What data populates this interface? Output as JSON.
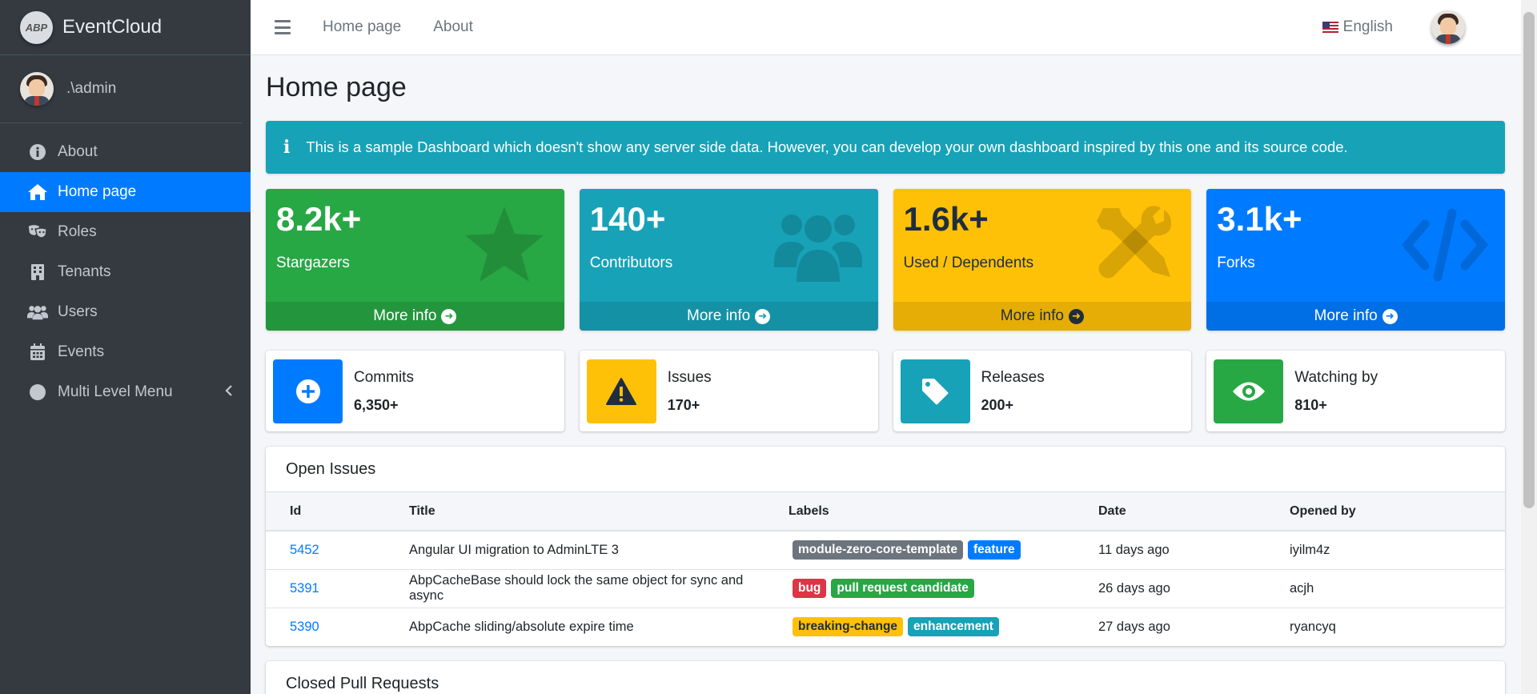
{
  "brand": {
    "name": "EventCloud",
    "logo_text": "ABP"
  },
  "user": {
    "name": ".\\admin"
  },
  "sidebar": {
    "items": [
      {
        "label": "About",
        "icon": "info-circle-icon",
        "active": false
      },
      {
        "label": "Home page",
        "icon": "home-icon",
        "active": true
      },
      {
        "label": "Roles",
        "icon": "theater-masks-icon",
        "active": false
      },
      {
        "label": "Tenants",
        "icon": "building-icon",
        "active": false
      },
      {
        "label": "Users",
        "icon": "users-icon",
        "active": false
      },
      {
        "label": "Events",
        "icon": "calendar-icon",
        "active": false
      },
      {
        "label": "Multi Level Menu",
        "icon": "circle-icon",
        "active": false
      }
    ]
  },
  "topbar": {
    "links": [
      "Home page",
      "About"
    ],
    "language": "English"
  },
  "page": {
    "title": "Home page",
    "callout": "This is a sample Dashboard which doesn't show any server side data. However, you can develop your own dashboard inspired by this one and its source code.",
    "callout_icon": "i"
  },
  "small_boxes": [
    {
      "value": "8.2k+",
      "label": "Stargazers",
      "more": "More info",
      "color": "#28a745",
      "icon": "star-icon"
    },
    {
      "value": "140+",
      "label": "Contributors",
      "more": "More info",
      "color": "#17a2b8",
      "icon": "users-icon"
    },
    {
      "value": "1.6k+",
      "label": "Used / Dependents",
      "more": "More info",
      "color": "#ffc107",
      "icon": "tools-icon"
    },
    {
      "value": "3.1k+",
      "label": "Forks",
      "more": "More info",
      "color": "#007bff",
      "icon": "code-icon"
    }
  ],
  "info_boxes": [
    {
      "label": "Commits",
      "number": "6,350+",
      "color": "#007bff",
      "icon": "plus-circle-icon"
    },
    {
      "label": "Issues",
      "number": "170+",
      "color": "#ffc107",
      "icon": "warning-icon"
    },
    {
      "label": "Releases",
      "number": "200+",
      "color": "#17a2b8",
      "icon": "tag-icon"
    },
    {
      "label": "Watching by",
      "number": "810+",
      "color": "#28a745",
      "icon": "eye-icon"
    }
  ],
  "open_issues": {
    "title": "Open Issues",
    "columns": [
      "Id",
      "Title",
      "Labels",
      "Date",
      "Opened by"
    ],
    "rows": [
      {
        "id": "5452",
        "title": "Angular UI migration to AdminLTE 3",
        "labels": [
          {
            "text": "module-zero-core-template",
            "color": "gray"
          },
          {
            "text": "feature",
            "color": "blue"
          }
        ],
        "date": "11 days ago",
        "by": "iyilm4z"
      },
      {
        "id": "5391",
        "title": "AbpCacheBase should lock the same object for sync and async",
        "labels": [
          {
            "text": "bug",
            "color": "red"
          },
          {
            "text": "pull request candidate",
            "color": "green"
          }
        ],
        "date": "26 days ago",
        "by": "acjh"
      },
      {
        "id": "5390",
        "title": "AbpCache sliding/absolute expire time",
        "labels": [
          {
            "text": "breaking-change",
            "color": "yellow"
          },
          {
            "text": "enhancement",
            "color": "teal"
          }
        ],
        "date": "27 days ago",
        "by": "ryancyq"
      }
    ]
  },
  "closed_prs": {
    "title": "Closed Pull Requests"
  }
}
